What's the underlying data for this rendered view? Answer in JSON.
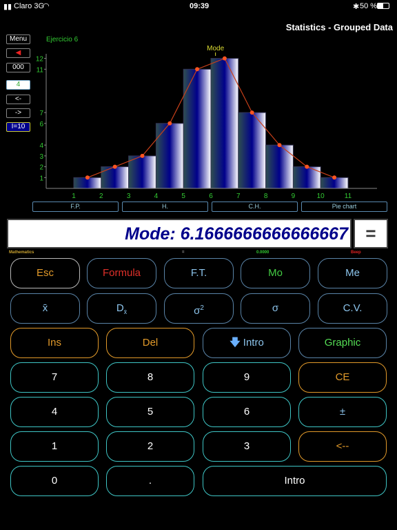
{
  "status": {
    "carrier": "Claro 3G",
    "time": "09:39",
    "battery": "50 %"
  },
  "header": {
    "title": "Statistics - Grouped Data"
  },
  "side": {
    "menu": "Menu",
    "counter": "000",
    "value": "4",
    "prev": "<-",
    "next": "->",
    "interval": "I=10"
  },
  "chart_data": {
    "type": "bar",
    "title": "Ejercicio 6",
    "annotation": "Mode",
    "x_ticks": [
      1,
      2,
      3,
      4,
      5,
      6,
      7,
      8,
      9,
      10,
      11
    ],
    "y_ticks": [
      1,
      2,
      3,
      4,
      6,
      7,
      11,
      12
    ],
    "bins": [
      [
        1,
        2
      ],
      [
        2,
        3
      ],
      [
        3,
        4
      ],
      [
        4,
        5
      ],
      [
        5,
        6
      ],
      [
        6,
        7
      ],
      [
        7,
        8
      ],
      [
        8,
        9
      ],
      [
        9,
        10
      ],
      [
        10,
        11
      ]
    ],
    "values": [
      1,
      2,
      3,
      6,
      11,
      12,
      7,
      4,
      2,
      1
    ],
    "polygon": {
      "x": [
        1.5,
        2.5,
        3.5,
        4.5,
        5.5,
        6.5,
        7.5,
        8.5,
        9.5,
        10.5
      ],
      "y": [
        1,
        2,
        3,
        6,
        11,
        12,
        7,
        4,
        2,
        1
      ],
      "color": "#ff5522"
    },
    "mode": 6.1667,
    "ylim": [
      0,
      13.5
    ],
    "xlim": [
      -0.1,
      12.1
    ]
  },
  "chart_buttons": [
    "F.P.",
    "H.",
    "C.H.",
    "Pie chart"
  ],
  "display": {
    "text": "Mode: 6.1666666666666667",
    "equals": "="
  },
  "indicators": {
    "mode": "Mathematics",
    "dot": "=",
    "precision": "0.0000",
    "beep": "Beep"
  },
  "keys": {
    "esc": "Esc",
    "formula": "Formula",
    "ft": "F.T.",
    "mo": "Mo",
    "me": "Me",
    "mean": "x̄",
    "dev": "D",
    "sub": "x̄",
    "var": "σ",
    "sup": "2",
    "sigma": "σ",
    "cv": "C.V.",
    "ins": "Ins",
    "del": "Del",
    "intro_down": "Intro",
    "graphic": "Graphic",
    "d7": "7",
    "d8": "8",
    "d9": "9",
    "ce": "CE",
    "d4": "4",
    "d5": "5",
    "d6": "6",
    "pm": "±",
    "d1": "1",
    "d2": "2",
    "d3": "3",
    "back": "<--",
    "d0": "0",
    "dot": ".",
    "intro": "Intro"
  }
}
